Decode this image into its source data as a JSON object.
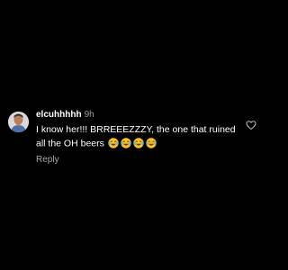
{
  "comment": {
    "username": "elcuhhhhh",
    "timestamp": "9h",
    "text": "I know her!!! BRREEEZZZY, the one that ruined all the OH beers",
    "emojis": [
      "face-with-tears-of-joy",
      "face-with-tears-of-joy",
      "face-with-tears-of-joy",
      "face-with-tears-of-joy"
    ],
    "reply_label": "Reply",
    "avatar_icon": "avatar-icon",
    "like_icon": "heart-outline-icon"
  },
  "theme": {
    "background": "#000000",
    "text": "#ffffff",
    "muted": "#9a9a9a",
    "emoji_yellow": "#f6c12b"
  }
}
